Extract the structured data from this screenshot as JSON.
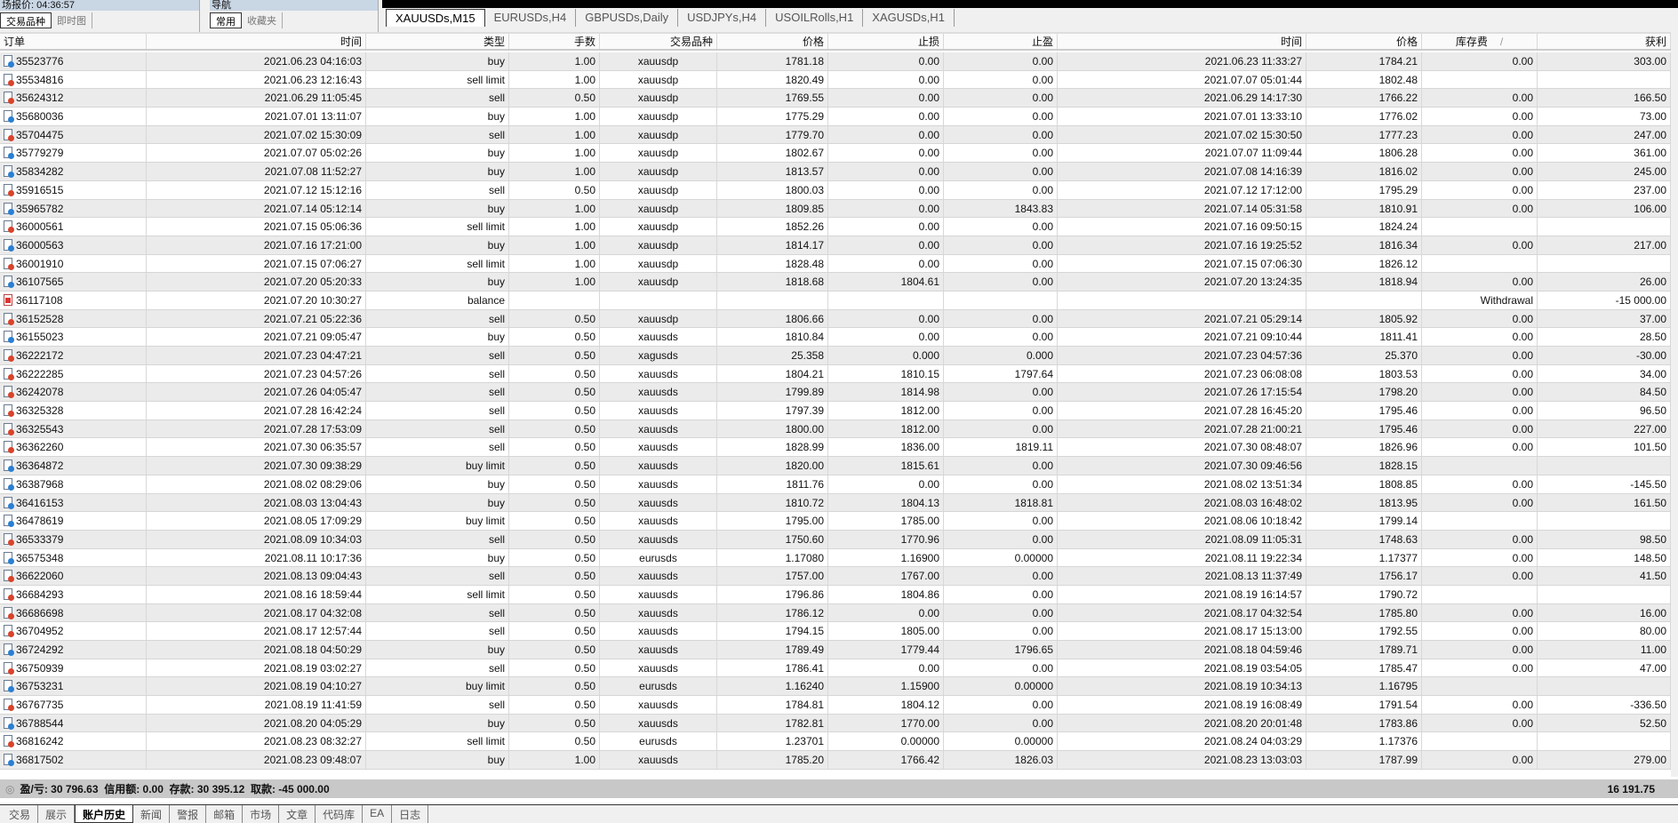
{
  "panels": {
    "market_watch": {
      "title": "场报价: 04:36:57",
      "tabs": [
        "交易品种",
        "即时图"
      ]
    },
    "navigator": {
      "title": "导航",
      "tabs": [
        "常用",
        "收藏夹"
      ]
    },
    "close": "x"
  },
  "chart_tabs": [
    "XAUUSDs,M15",
    "EURUSDs,H4",
    "GBPUSDs,Daily",
    "USDJPYs,H4",
    "USOILRolls,H1",
    "XAGUSDs,H1"
  ],
  "columns": [
    "订单",
    "时间",
    "类型",
    "手数",
    "交易品种",
    "价格",
    "止损",
    "止盈",
    "时间",
    "价格",
    "库存费",
    "获利"
  ],
  "sort_indicator": "/",
  "rows": [
    [
      "35523776",
      "2021.06.23 04:16:03",
      "buy",
      "1.00",
      "xauusdp",
      "1781.18",
      "0.00",
      "0.00",
      "2021.06.23 11:33:27",
      "1784.21",
      "0.00",
      "303.00"
    ],
    [
      "35534816",
      "2021.06.23 12:16:43",
      "sell limit",
      "1.00",
      "xauusdp",
      "1820.49",
      "0.00",
      "0.00",
      "2021.07.07 05:01:44",
      "1802.48",
      "",
      ""
    ],
    [
      "35624312",
      "2021.06.29 11:05:45",
      "sell",
      "0.50",
      "xauusdp",
      "1769.55",
      "0.00",
      "0.00",
      "2021.06.29 14:17:30",
      "1766.22",
      "0.00",
      "166.50"
    ],
    [
      "35680036",
      "2021.07.01 13:11:07",
      "buy",
      "1.00",
      "xauusdp",
      "1775.29",
      "0.00",
      "0.00",
      "2021.07.01 13:33:10",
      "1776.02",
      "0.00",
      "73.00"
    ],
    [
      "35704475",
      "2021.07.02 15:30:09",
      "sell",
      "1.00",
      "xauusdp",
      "1779.70",
      "0.00",
      "0.00",
      "2021.07.02 15:30:50",
      "1777.23",
      "0.00",
      "247.00"
    ],
    [
      "35779279",
      "2021.07.07 05:02:26",
      "buy",
      "1.00",
      "xauusdp",
      "1802.67",
      "0.00",
      "0.00",
      "2021.07.07 11:09:44",
      "1806.28",
      "0.00",
      "361.00"
    ],
    [
      "35834282",
      "2021.07.08 11:52:27",
      "buy",
      "1.00",
      "xauusdp",
      "1813.57",
      "0.00",
      "0.00",
      "2021.07.08 14:16:39",
      "1816.02",
      "0.00",
      "245.00"
    ],
    [
      "35916515",
      "2021.07.12 15:12:16",
      "sell",
      "0.50",
      "xauusdp",
      "1800.03",
      "0.00",
      "0.00",
      "2021.07.12 17:12:00",
      "1795.29",
      "0.00",
      "237.00"
    ],
    [
      "35965782",
      "2021.07.14 05:12:14",
      "buy",
      "1.00",
      "xauusdp",
      "1809.85",
      "0.00",
      "1843.83",
      "2021.07.14 05:31:58",
      "1810.91",
      "0.00",
      "106.00"
    ],
    [
      "36000561",
      "2021.07.15 05:06:36",
      "sell limit",
      "1.00",
      "xauusdp",
      "1852.26",
      "0.00",
      "0.00",
      "2021.07.16 09:50:15",
      "1824.24",
      "",
      ""
    ],
    [
      "36000563",
      "2021.07.16 17:21:00",
      "buy",
      "1.00",
      "xauusdp",
      "1814.17",
      "0.00",
      "0.00",
      "2021.07.16 19:25:52",
      "1816.34",
      "0.00",
      "217.00"
    ],
    [
      "36001910",
      "2021.07.15 07:06:27",
      "sell limit",
      "1.00",
      "xauusdp",
      "1828.48",
      "0.00",
      "0.00",
      "2021.07.15 07:06:30",
      "1826.12",
      "",
      ""
    ],
    [
      "36107565",
      "2021.07.20 05:20:33",
      "buy",
      "1.00",
      "xauusdp",
      "1818.68",
      "1804.61",
      "0.00",
      "2021.07.20 13:24:35",
      "1818.94",
      "0.00",
      "26.00"
    ],
    [
      "36117108",
      "2021.07.20 10:30:27",
      "balance",
      "",
      "",
      "",
      "",
      "",
      "",
      "",
      "Withdrawal",
      "-15 000.00"
    ],
    [
      "36152528",
      "2021.07.21 05:22:36",
      "sell",
      "0.50",
      "xauusdp",
      "1806.66",
      "0.00",
      "0.00",
      "2021.07.21 05:29:14",
      "1805.92",
      "0.00",
      "37.00"
    ],
    [
      "36155023",
      "2021.07.21 09:05:47",
      "buy",
      "0.50",
      "xauusds",
      "1810.84",
      "0.00",
      "0.00",
      "2021.07.21 09:10:44",
      "1811.41",
      "0.00",
      "28.50"
    ],
    [
      "36222172",
      "2021.07.23 04:47:21",
      "sell",
      "0.50",
      "xagusds",
      "25.358",
      "0.000",
      "0.000",
      "2021.07.23 04:57:36",
      "25.370",
      "0.00",
      "-30.00"
    ],
    [
      "36222285",
      "2021.07.23 04:57:26",
      "sell",
      "0.50",
      "xauusds",
      "1804.21",
      "1810.15",
      "1797.64",
      "2021.07.23 06:08:08",
      "1803.53",
      "0.00",
      "34.00"
    ],
    [
      "36242078",
      "2021.07.26 04:05:47",
      "sell",
      "0.50",
      "xauusds",
      "1799.89",
      "1814.98",
      "0.00",
      "2021.07.26 17:15:54",
      "1798.20",
      "0.00",
      "84.50"
    ],
    [
      "36325328",
      "2021.07.28 16:42:24",
      "sell",
      "0.50",
      "xauusds",
      "1797.39",
      "1812.00",
      "0.00",
      "2021.07.28 16:45:20",
      "1795.46",
      "0.00",
      "96.50"
    ],
    [
      "36325543",
      "2021.07.28 17:53:09",
      "sell",
      "0.50",
      "xauusds",
      "1800.00",
      "1812.00",
      "0.00",
      "2021.07.28 21:00:21",
      "1795.46",
      "0.00",
      "227.00"
    ],
    [
      "36362260",
      "2021.07.30 06:35:57",
      "sell",
      "0.50",
      "xauusds",
      "1828.99",
      "1836.00",
      "1819.11",
      "2021.07.30 08:48:07",
      "1826.96",
      "0.00",
      "101.50"
    ],
    [
      "36364872",
      "2021.07.30 09:38:29",
      "buy limit",
      "0.50",
      "xauusds",
      "1820.00",
      "1815.61",
      "0.00",
      "2021.07.30 09:46:56",
      "1828.15",
      "",
      ""
    ],
    [
      "36387968",
      "2021.08.02 08:29:06",
      "buy",
      "0.50",
      "xauusds",
      "1811.76",
      "0.00",
      "0.00",
      "2021.08.02 13:51:34",
      "1808.85",
      "0.00",
      "-145.50"
    ],
    [
      "36416153",
      "2021.08.03 13:04:43",
      "buy",
      "0.50",
      "xauusds",
      "1810.72",
      "1804.13",
      "1818.81",
      "2021.08.03 16:48:02",
      "1813.95",
      "0.00",
      "161.50"
    ],
    [
      "36478619",
      "2021.08.05 17:09:29",
      "buy limit",
      "0.50",
      "xauusds",
      "1795.00",
      "1785.00",
      "0.00",
      "2021.08.06 10:18:42",
      "1799.14",
      "",
      ""
    ],
    [
      "36533379",
      "2021.08.09 10:34:03",
      "sell",
      "0.50",
      "xauusds",
      "1750.60",
      "1770.96",
      "0.00",
      "2021.08.09 11:05:31",
      "1748.63",
      "0.00",
      "98.50"
    ],
    [
      "36575348",
      "2021.08.11 10:17:36",
      "buy",
      "0.50",
      "eurusds",
      "1.17080",
      "1.16900",
      "0.00000",
      "2021.08.11 19:22:34",
      "1.17377",
      "0.00",
      "148.50"
    ],
    [
      "36622060",
      "2021.08.13 09:04:43",
      "sell",
      "0.50",
      "xauusds",
      "1757.00",
      "1767.00",
      "0.00",
      "2021.08.13 11:37:49",
      "1756.17",
      "0.00",
      "41.50"
    ],
    [
      "36684293",
      "2021.08.16 18:59:44",
      "sell limit",
      "0.50",
      "xauusds",
      "1796.86",
      "1804.86",
      "0.00",
      "2021.08.19 16:14:57",
      "1790.72",
      "",
      ""
    ],
    [
      "36686698",
      "2021.08.17 04:32:08",
      "sell",
      "0.50",
      "xauusds",
      "1786.12",
      "0.00",
      "0.00",
      "2021.08.17 04:32:54",
      "1785.80",
      "0.00",
      "16.00"
    ],
    [
      "36704952",
      "2021.08.17 12:57:44",
      "sell",
      "0.50",
      "xauusds",
      "1794.15",
      "1805.00",
      "0.00",
      "2021.08.17 15:13:00",
      "1792.55",
      "0.00",
      "80.00"
    ],
    [
      "36724292",
      "2021.08.18 04:50:29",
      "buy",
      "0.50",
      "xauusds",
      "1789.49",
      "1779.44",
      "1796.65",
      "2021.08.18 04:59:46",
      "1789.71",
      "0.00",
      "11.00"
    ],
    [
      "36750939",
      "2021.08.19 03:02:27",
      "sell",
      "0.50",
      "xauusds",
      "1786.41",
      "0.00",
      "0.00",
      "2021.08.19 03:54:05",
      "1785.47",
      "0.00",
      "47.00"
    ],
    [
      "36753231",
      "2021.08.19 04:10:27",
      "buy limit",
      "0.50",
      "eurusds",
      "1.16240",
      "1.15900",
      "0.00000",
      "2021.08.19 10:34:13",
      "1.16795",
      "",
      ""
    ],
    [
      "36767735",
      "2021.08.19 11:41:59",
      "sell",
      "0.50",
      "xauusds",
      "1784.81",
      "1804.12",
      "0.00",
      "2021.08.19 16:08:49",
      "1791.54",
      "0.00",
      "-336.50"
    ],
    [
      "36788544",
      "2021.08.20 04:05:29",
      "buy",
      "0.50",
      "xauusds",
      "1782.81",
      "1770.00",
      "0.00",
      "2021.08.20 20:01:48",
      "1783.86",
      "0.00",
      "52.50"
    ],
    [
      "36816242",
      "2021.08.23 08:32:27",
      "sell limit",
      "0.50",
      "eurusds",
      "1.23701",
      "0.00000",
      "0.00000",
      "2021.08.24 04:03:29",
      "1.17376",
      "",
      ""
    ],
    [
      "36817502",
      "2021.08.23 09:48:07",
      "buy",
      "1.00",
      "xauusds",
      "1785.20",
      "1766.42",
      "1826.03",
      "2021.08.23 13:03:03",
      "1787.99",
      "0.00",
      "279.00"
    ]
  ],
  "summary": {
    "text": "盈/亏: 30 796.63  信用额: 0.00  存款: 30 395.12  取款: -45 000.00",
    "total": "16 191.75"
  },
  "bottom_tabs": [
    "交易",
    "展示",
    "账户历史",
    "新闻",
    "警报",
    "邮箱",
    "市场",
    "文章",
    "代码库",
    "EA",
    "日志"
  ],
  "active_bottom_tab": "账户历史",
  "colors": {
    "buy": "#2a7fd4",
    "sell": "#d9432a",
    "row_alt": "#ebebeb",
    "summary_bar": "#c8c8c8"
  }
}
